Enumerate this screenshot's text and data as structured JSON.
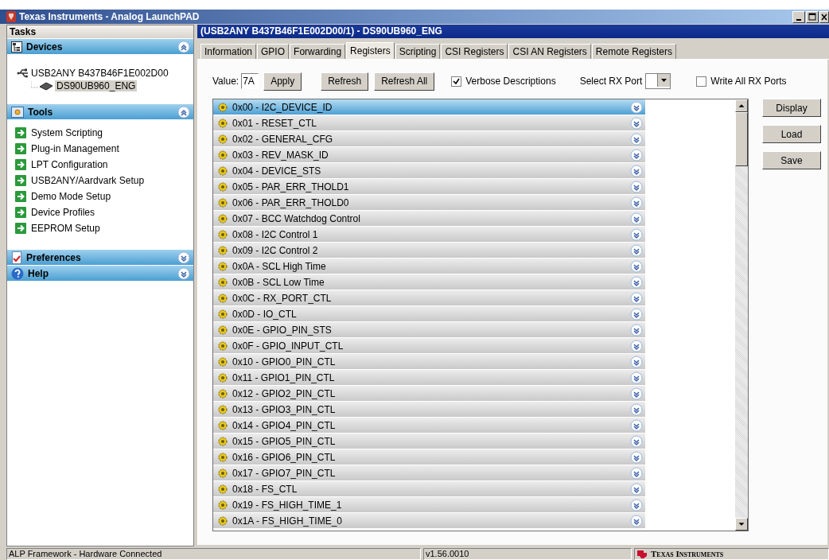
{
  "window": {
    "title": "Texas Instruments - Analog LaunchPAD"
  },
  "tasks": {
    "title": "Tasks",
    "sections": [
      {
        "title": "Devices",
        "kind": "devices",
        "expanded": true,
        "tree": [
          {
            "label": "USB2ANY B437B46F1E002D00",
            "selected": false,
            "children": [
              {
                "label": "DS90UB960_ENG",
                "selected": true
              }
            ]
          }
        ]
      },
      {
        "title": "Tools",
        "kind": "tools",
        "expanded": true,
        "items": [
          "System Scripting",
          "Plug-in Management",
          "LPT Configuration",
          "USB2ANY/Aardvark Setup",
          "Demo Mode Setup",
          "Device Profiles",
          "EEPROM Setup"
        ]
      },
      {
        "title": "Preferences",
        "kind": "preferences",
        "expanded": false
      },
      {
        "title": "Help",
        "kind": "help",
        "expanded": false
      }
    ]
  },
  "panel": {
    "title": "(USB2ANY B437B46F1E002D00/1) - DS90UB960_ENG",
    "tabs": [
      {
        "label": "Information",
        "selected": false
      },
      {
        "label": "GPIO",
        "selected": false
      },
      {
        "label": "Forwarding",
        "selected": false
      },
      {
        "label": "Registers",
        "selected": true
      },
      {
        "label": "Scripting",
        "selected": false
      },
      {
        "label": "CSI Registers",
        "selected": false
      },
      {
        "label": "CSI AN Registers",
        "selected": false
      },
      {
        "label": "Remote Registers",
        "selected": false
      }
    ],
    "toolbar": {
      "value_label": "Value:",
      "value": "7A",
      "buttons": [
        "Apply",
        "Refresh",
        "Refresh All"
      ],
      "verbose": {
        "label": "Verbose Descriptions",
        "checked": true
      },
      "rx_port_label": "Select RX Port",
      "write_all": {
        "label": "Write All RX Ports",
        "checked": false
      }
    },
    "registers": [
      {
        "label": "0x00 - I2C_DEVICE_ID",
        "selected": true
      },
      {
        "label": "0x01 - RESET_CTL",
        "selected": false
      },
      {
        "label": "0x02 - GENERAL_CFG",
        "selected": false
      },
      {
        "label": "0x03 - REV_MASK_ID",
        "selected": false
      },
      {
        "label": "0x04 - DEVICE_STS",
        "selected": false
      },
      {
        "label": "0x05 - PAR_ERR_THOLD1",
        "selected": false
      },
      {
        "label": "0x06 - PAR_ERR_THOLD0",
        "selected": false
      },
      {
        "label": "0x07 - BCC Watchdog Control",
        "selected": false
      },
      {
        "label": "0x08 - I2C Control 1",
        "selected": false
      },
      {
        "label": "0x09 - I2C Control 2",
        "selected": false
      },
      {
        "label": "0x0A - SCL High Time",
        "selected": false
      },
      {
        "label": "0x0B - SCL Low Time",
        "selected": false
      },
      {
        "label": "0x0C - RX_PORT_CTL",
        "selected": false
      },
      {
        "label": "0x0D - IO_CTL",
        "selected": false
      },
      {
        "label": "0x0E - GPIO_PIN_STS",
        "selected": false
      },
      {
        "label": "0x0F - GPIO_INPUT_CTL",
        "selected": false
      },
      {
        "label": "0x10 - GPIO0_PIN_CTL",
        "selected": false
      },
      {
        "label": "0x11 - GPIO1_PIN_CTL",
        "selected": false
      },
      {
        "label": "0x12 - GPIO2_PIN_CTL",
        "selected": false
      },
      {
        "label": "0x13 - GPIO3_PIN_CTL",
        "selected": false
      },
      {
        "label": "0x14 - GPIO4_PIN_CTL",
        "selected": false
      },
      {
        "label": "0x15 - GPIO5_PIN_CTL",
        "selected": false
      },
      {
        "label": "0x16 - GPIO6_PIN_CTL",
        "selected": false
      },
      {
        "label": "0x17 - GPIO7_PIN_CTL",
        "selected": false
      },
      {
        "label": "0x18 - FS_CTL",
        "selected": false
      },
      {
        "label": "0x19 - FS_HIGH_TIME_1",
        "selected": false
      },
      {
        "label": "0x1A - FS_HIGH_TIME_0",
        "selected": false
      }
    ],
    "side_buttons": [
      "Display",
      "Load",
      "Save"
    ]
  },
  "status_bar": {
    "message": "ALP Framework - Hardware Connected",
    "version": "v1.56.0010",
    "brand": "Texas Instruments"
  }
}
